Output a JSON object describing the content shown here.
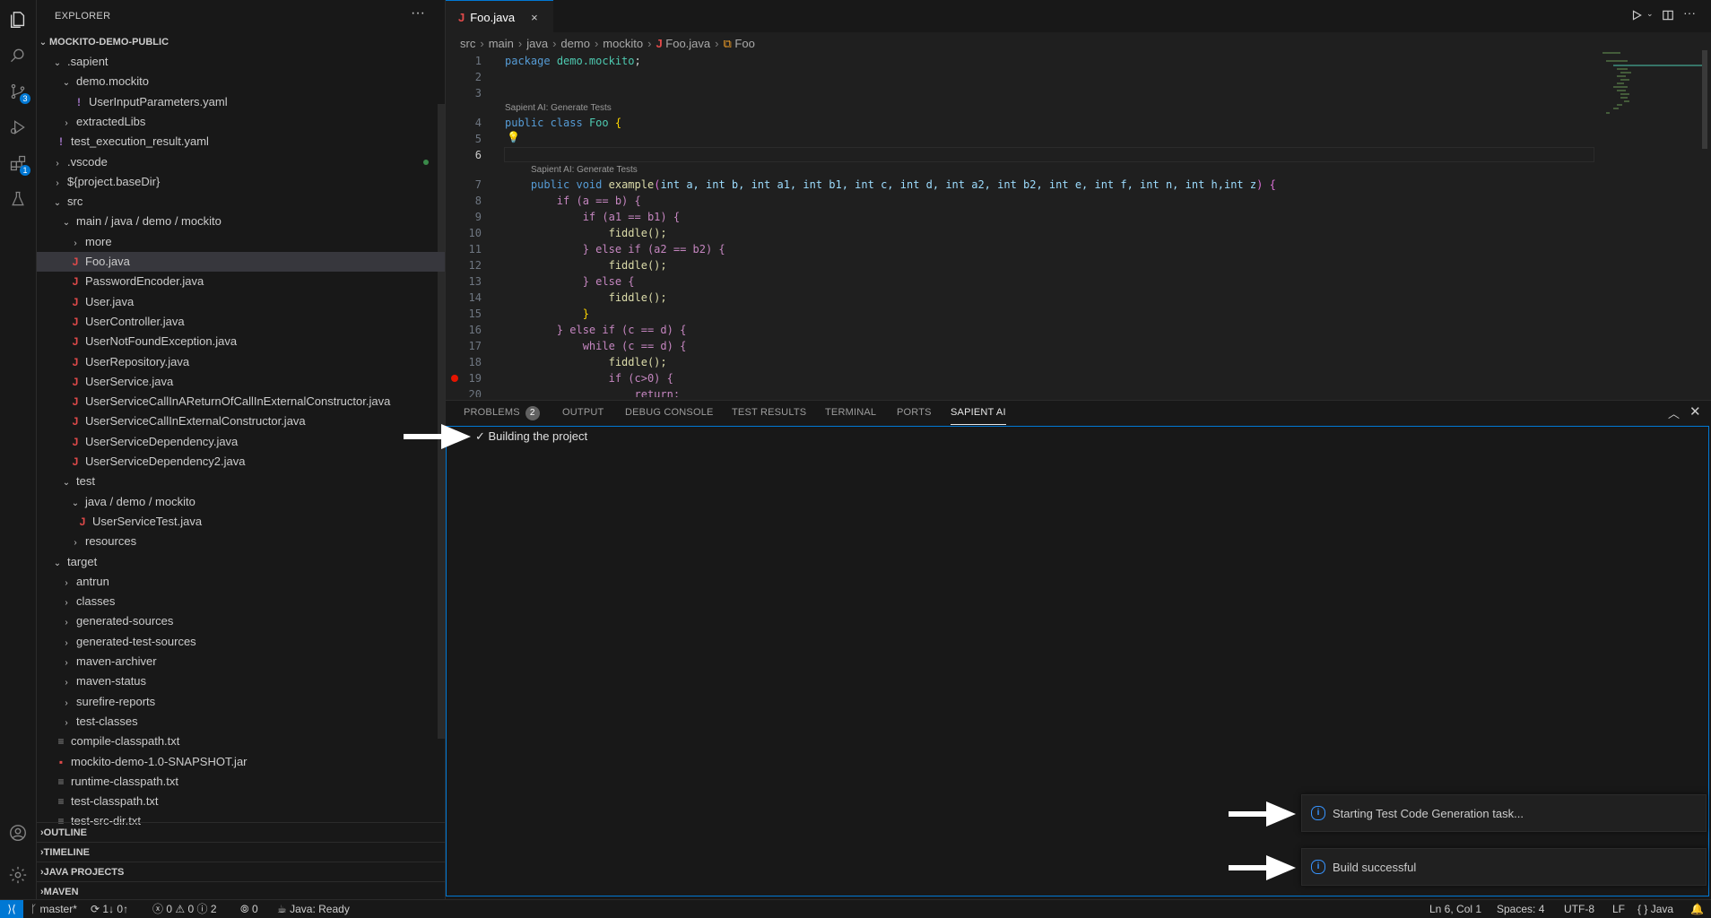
{
  "activity_bar": {
    "scm_badge": "3",
    "extensions_badge": "1"
  },
  "explorer": {
    "title": "EXPLORER",
    "more": "···",
    "project": "MOCKITO-DEMO-PUBLIC",
    "tree": [
      {
        "label": ".sapient",
        "type": "folder-open"
      },
      {
        "label": "demo.mockito",
        "type": "folder-open"
      },
      {
        "label": "UserInputParameters.yaml",
        "type": "yaml"
      },
      {
        "label": "extractedLibs",
        "type": "folder"
      },
      {
        "label": "test_execution_result.yaml",
        "type": "yaml"
      },
      {
        "label": ".vscode",
        "type": "folder"
      },
      {
        "label": "${project.baseDir}",
        "type": "folder"
      },
      {
        "label": "src",
        "type": "folder-open"
      },
      {
        "label": "main / java / demo / mockito",
        "type": "folder-open"
      },
      {
        "label": "more",
        "type": "folder"
      },
      {
        "label": "Foo.java",
        "type": "java"
      },
      {
        "label": "PasswordEncoder.java",
        "type": "java"
      },
      {
        "label": "User.java",
        "type": "java"
      },
      {
        "label": "UserController.java",
        "type": "java"
      },
      {
        "label": "UserNotFoundException.java",
        "type": "java"
      },
      {
        "label": "UserRepository.java",
        "type": "java"
      },
      {
        "label": "UserService.java",
        "type": "java"
      },
      {
        "label": "UserServiceCallInAReturnOfCallInExternalConstructor.java",
        "type": "java"
      },
      {
        "label": "UserServiceCallInExternalConstructor.java",
        "type": "java"
      },
      {
        "label": "UserServiceDependency.java",
        "type": "java"
      },
      {
        "label": "UserServiceDependency2.java",
        "type": "java"
      },
      {
        "label": "test",
        "type": "folder-open"
      },
      {
        "label": "java / demo / mockito",
        "type": "folder-open"
      },
      {
        "label": "UserServiceTest.java",
        "type": "java"
      },
      {
        "label": "resources",
        "type": "folder"
      },
      {
        "label": "target",
        "type": "folder-open"
      },
      {
        "label": "antrun",
        "type": "folder"
      },
      {
        "label": "classes",
        "type": "folder"
      },
      {
        "label": "generated-sources",
        "type": "folder"
      },
      {
        "label": "generated-test-sources",
        "type": "folder"
      },
      {
        "label": "maven-archiver",
        "type": "folder"
      },
      {
        "label": "maven-status",
        "type": "folder"
      },
      {
        "label": "surefire-reports",
        "type": "folder"
      },
      {
        "label": "test-classes",
        "type": "folder"
      },
      {
        "label": "compile-classpath.txt",
        "type": "txt"
      },
      {
        "label": "mockito-demo-1.0-SNAPSHOT.jar",
        "type": "jar"
      },
      {
        "label": "runtime-classpath.txt",
        "type": "txt"
      },
      {
        "label": "test-classpath.txt",
        "type": "txt"
      },
      {
        "label": "test-src-dir.txt",
        "type": "txt"
      }
    ],
    "sections": [
      "OUTLINE",
      "TIMELINE",
      "JAVA PROJECTS",
      "MAVEN"
    ]
  },
  "editor": {
    "tab": {
      "label": "Foo.java",
      "icon": "J",
      "close": "×"
    },
    "breadcrumb": [
      "src",
      "main",
      "java",
      "demo",
      "mockito",
      "Foo.java",
      "Foo"
    ],
    "lens_1": "Sapient AI: Generate Tests",
    "lens_2": "Sapient AI: Generate Tests",
    "line_numbers": [
      "1",
      "2",
      "3",
      "4",
      "5",
      "6",
      "7",
      "8",
      "9",
      "10",
      "11",
      "12",
      "13",
      "14",
      "15",
      "16",
      "17",
      "18",
      "19",
      "20"
    ],
    "code": {
      "l1_kw": "package",
      "l1_pkg": "demo.mockito",
      "l1_end": ";",
      "l4_kw": "public class",
      "l4_name": "Foo",
      "l4_brace": "{",
      "l7_kw": "public void",
      "l7_fn": "example",
      "l7_params": "int a, int b, int a1, int b1, int c, int d, int a2, int b2, int e, int f, int n, int h,int z",
      "l8": "if (a == b) {",
      "l9": "if (a1 == b1) {",
      "l10": "fiddle();",
      "l11": "} else if (a2 == b2) {",
      "l12": "fiddle();",
      "l13": "} else {",
      "l14": "fiddle();",
      "l15": "}",
      "l16": "} else if (c == d) {",
      "l17": "while (c == d) {",
      "l18": "fiddle();",
      "l19": "if (c>0) {",
      "l20": "return;"
    }
  },
  "panel": {
    "tabs": [
      "PROBLEMS",
      "OUTPUT",
      "DEBUG CONSOLE",
      "TEST RESULTS",
      "TERMINAL",
      "PORTS",
      "SAPIENT AI"
    ],
    "problems_count": "2",
    "status_line": "✓ Building the project"
  },
  "notifications": [
    {
      "text": "Starting Test Code Generation task...",
      "icon": "info-icon"
    },
    {
      "text": "Build successful",
      "icon": "info-icon"
    }
  ],
  "status_bar": {
    "branch": "master*",
    "sync": "1↓ 0↑",
    "errors": "0",
    "warnings": "0",
    "infos": "2",
    "ports": "0",
    "java": "Java: Ready",
    "position": "Ln 6, Col 1",
    "spaces": "Spaces: 4",
    "encoding": "UTF-8",
    "eol": "LF",
    "language": "Java",
    "language_icon": "{ }"
  },
  "colors": {
    "accent": "#0078d4",
    "java_icon": "#e04a4a",
    "breakpoint": "#e51400"
  }
}
